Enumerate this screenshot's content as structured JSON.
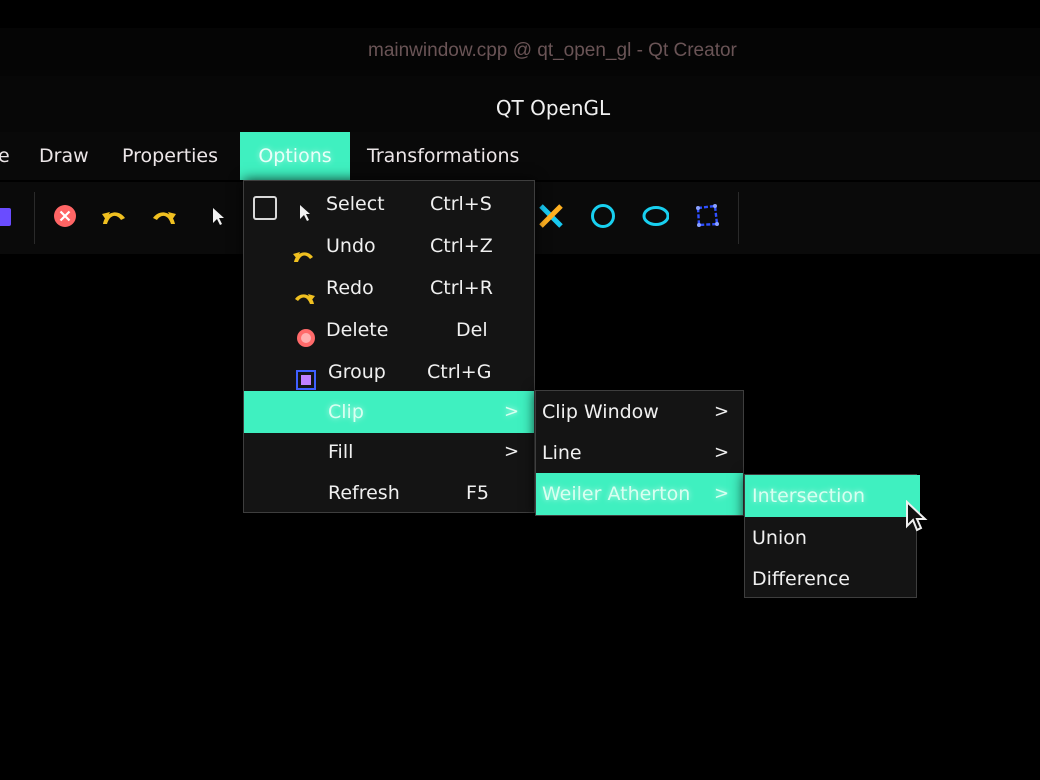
{
  "window": {
    "outer_title": "mainwindow.cpp @ qt_open_gl - Qt Creator",
    "title": "QT OpenGL"
  },
  "menubar": {
    "items": [
      {
        "label": "e"
      },
      {
        "label": "Draw"
      },
      {
        "label": "Properties"
      },
      {
        "label": "Options"
      },
      {
        "label": "Transformations"
      }
    ]
  },
  "toolbar": {
    "icons": [
      "palette-icon",
      "delete-icon",
      "undo-icon",
      "redo-icon",
      "select-arrow-icon",
      "clip-x-icon",
      "circle-icon",
      "ellipse-icon",
      "polygon-icon"
    ]
  },
  "options_menu": {
    "items": [
      {
        "label": "Select",
        "shortcut": "Ctrl+S",
        "icon": "select-arrow-icon",
        "checkbox": true
      },
      {
        "label": "Undo",
        "shortcut": "Ctrl+Z",
        "icon": "undo-icon"
      },
      {
        "label": "Redo",
        "shortcut": "Ctrl+R",
        "icon": "redo-icon"
      },
      {
        "label": "Delete",
        "shortcut": "Del",
        "icon": "delete-icon"
      },
      {
        "label": "Group",
        "shortcut": "Ctrl+G",
        "icon": "group-icon"
      },
      {
        "label": "Clip",
        "submenu": true,
        "arrow": ">"
      },
      {
        "label": "Fill",
        "submenu": true,
        "arrow": ">"
      },
      {
        "label": "Refresh",
        "shortcut": "F5"
      }
    ]
  },
  "clip_menu": {
    "items": [
      {
        "label": "Clip Window",
        "arrow": ">"
      },
      {
        "label": "Line",
        "arrow": ">"
      },
      {
        "label": "Weiler Atherton",
        "arrow": ">"
      }
    ]
  },
  "weiler_menu": {
    "items": [
      {
        "label": "Intersection"
      },
      {
        "label": "Union"
      },
      {
        "label": "Difference"
      }
    ]
  },
  "colors": {
    "highlight": "#3ff0c0",
    "undo_yellow": "#f0c020",
    "delete_red": "#ff6060",
    "shape_cyan": "#18d0f0",
    "polygon_blue": "#3050ff"
  }
}
